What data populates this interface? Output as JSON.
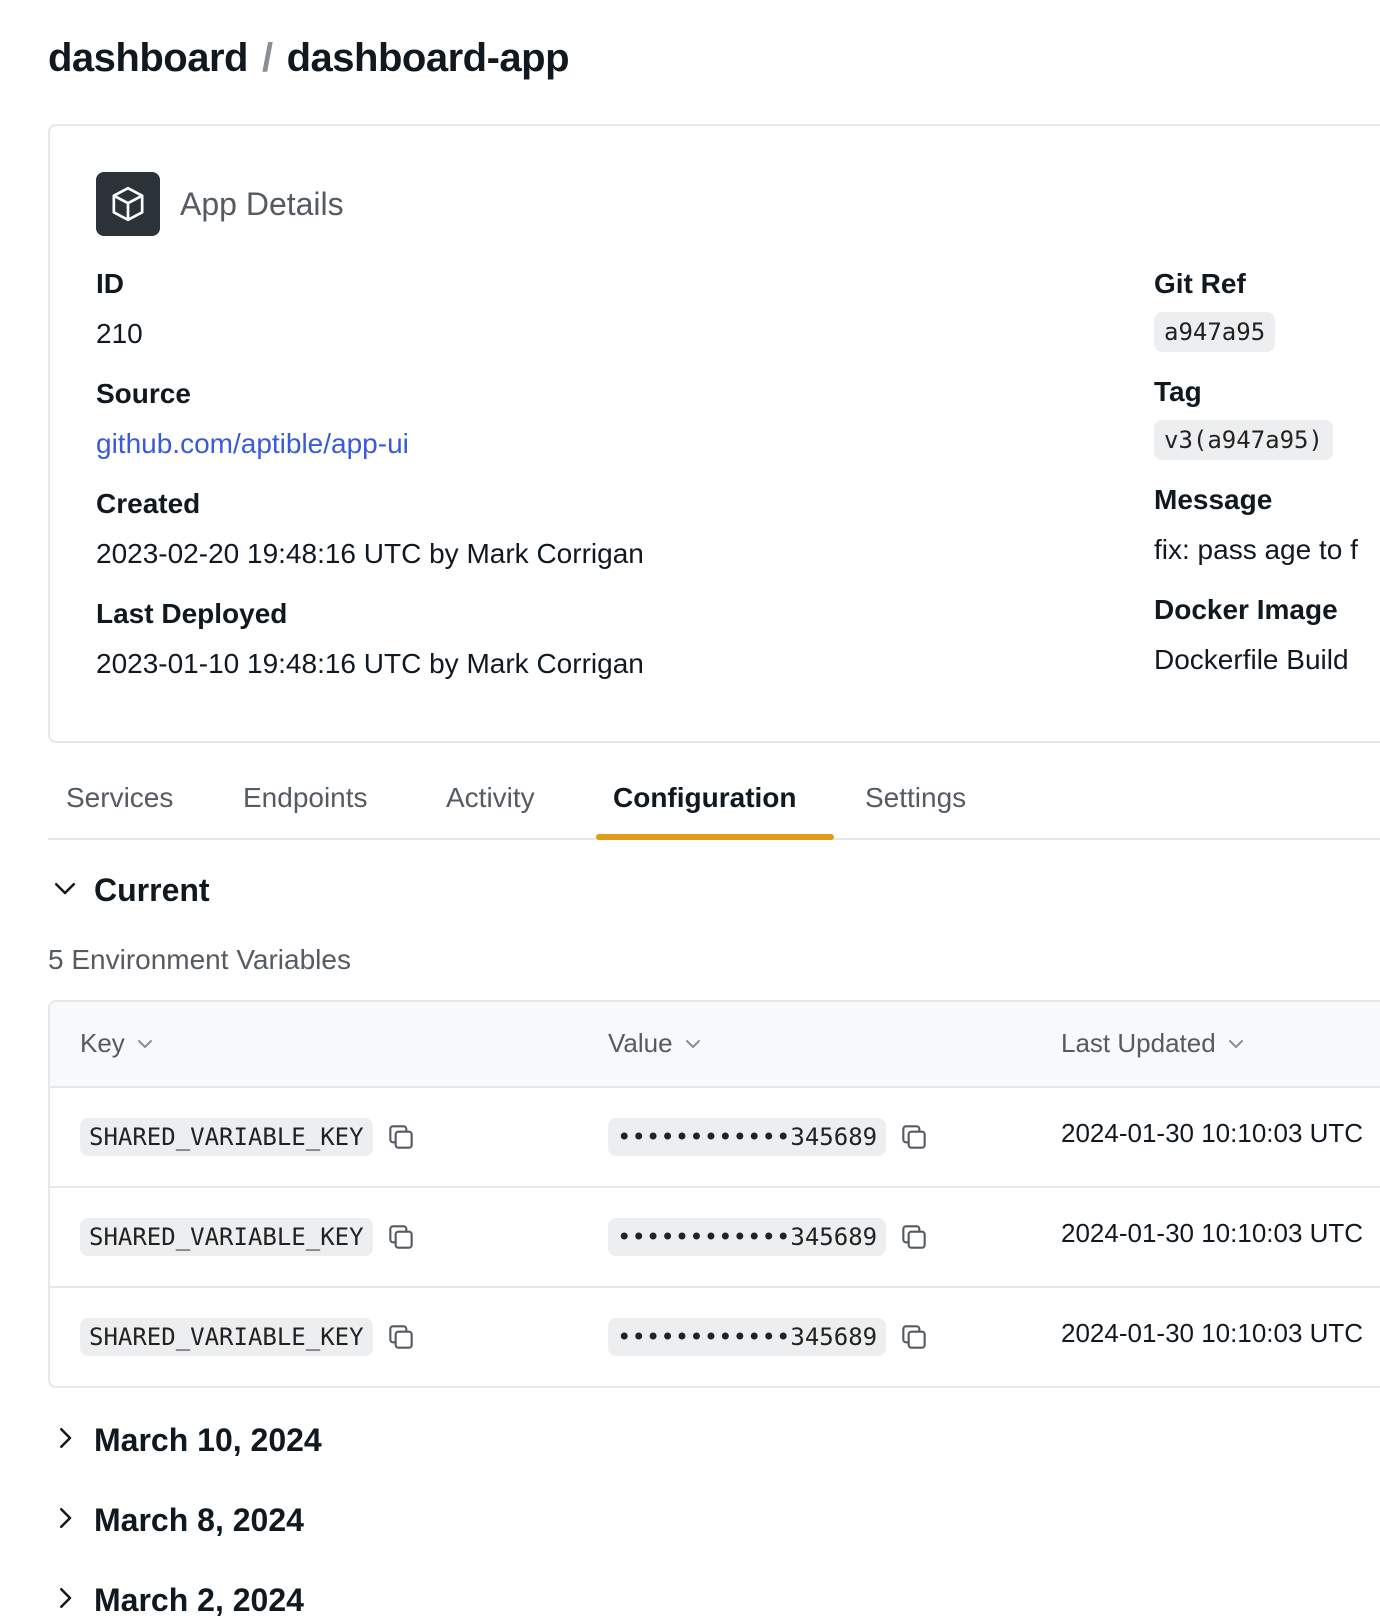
{
  "breadcrumb": {
    "parent": "dashboard",
    "separator": "/",
    "current": "dashboard-app"
  },
  "app_details": {
    "title": "App Details",
    "icon": "cube-icon",
    "fields_left": [
      {
        "label": "ID",
        "value": "210"
      },
      {
        "label": "Source",
        "value": "github.com/aptible/app-ui"
      },
      {
        "label": "Created",
        "value": "2023-02-20 19:48:16 UTC by Mark Corrigan"
      },
      {
        "label": "Last Deployed",
        "value": "2023-01-10 19:48:16 UTC by Mark Corrigan"
      }
    ],
    "fields_right": [
      {
        "label": "Git Ref",
        "value": "a947a95"
      },
      {
        "label": "Tag",
        "value": "v3(a947a95)"
      },
      {
        "label": "Message",
        "value": "fix: pass age to f"
      },
      {
        "label": "Docker Image",
        "value": "Dockerfile Build"
      }
    ]
  },
  "tabs": [
    "Services",
    "Endpoints",
    "Activity",
    "Configuration",
    "Settings"
  ],
  "active_tab": "Configuration",
  "current_section": {
    "title": "Current",
    "env_count": "5 Environment Variables",
    "columns": [
      "Key",
      "Value",
      "Last Updated"
    ],
    "rows": [
      {
        "key": "SHARED_VARIABLE_KEY",
        "value": "••••••••••••345689",
        "updated": "2024-01-30 10:10:03 UTC"
      },
      {
        "key": "SHARED_VARIABLE_KEY",
        "value": "••••••••••••345689",
        "updated": "2024-01-30 10:10:03 UTC"
      },
      {
        "key": "SHARED_VARIABLE_KEY",
        "value": "••••••••••••345689",
        "updated": "2024-01-30 10:10:03 UTC"
      }
    ]
  },
  "history_sections": [
    "March 10, 2024",
    "March 8, 2024",
    "March 2, 2024"
  ],
  "colors": {
    "accent": "#e19b16",
    "link": "#3a5bd9",
    "icon_bg": "#2b3339",
    "border": "#e6e7e9"
  }
}
